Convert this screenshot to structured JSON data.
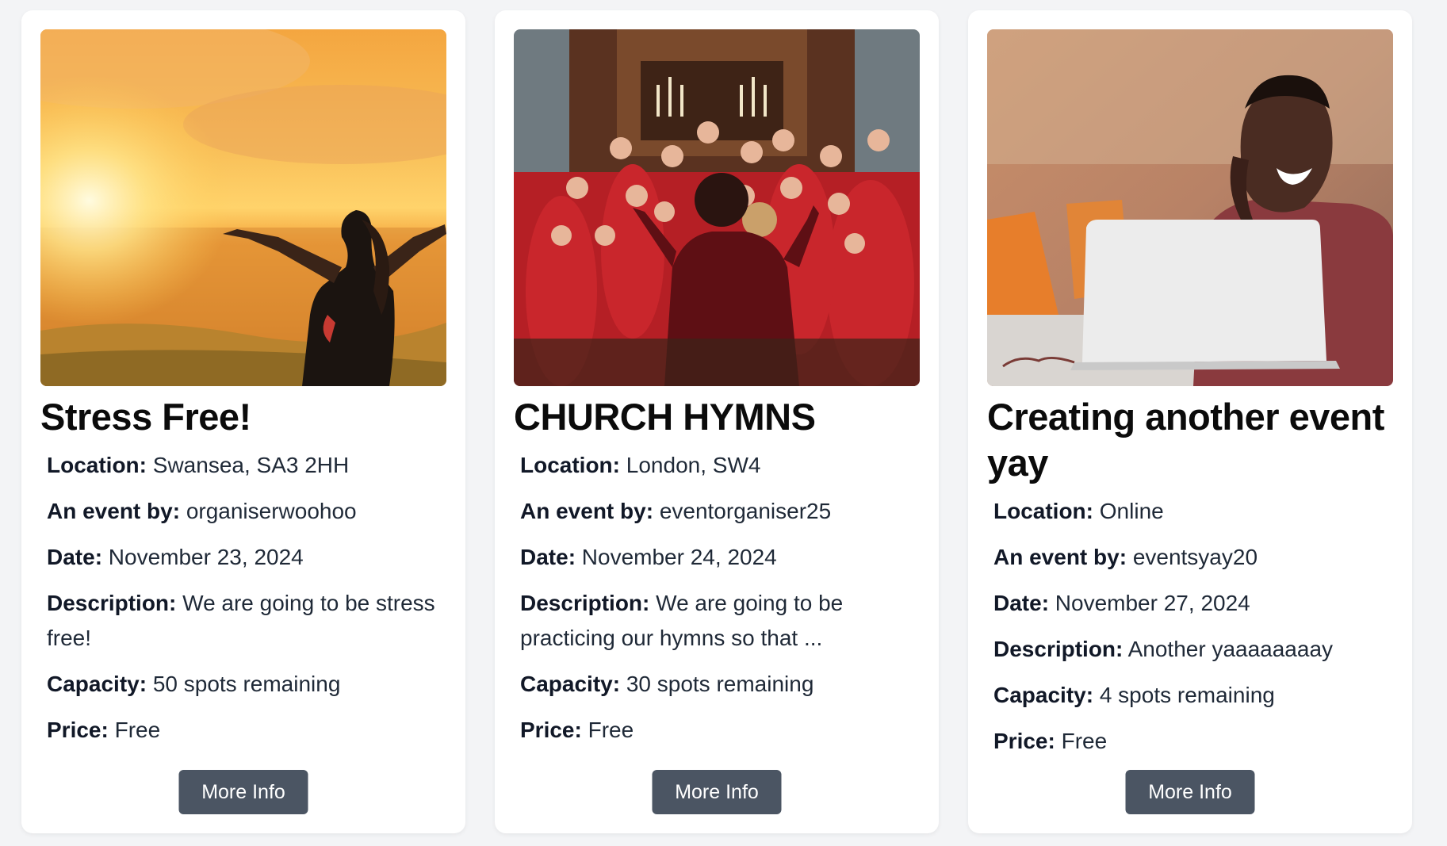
{
  "events": [
    {
      "title": "Stress Free!",
      "location_label": "Location:",
      "location": "Swansea, SA3 2HH",
      "organiser_label": "An event by:",
      "organiser": "organiserwoohoo",
      "date_label": "Date:",
      "date": "November 23, 2024",
      "description_label": "Description:",
      "description": "We are going to be stress free!",
      "capacity_label": "Capacity:",
      "capacity": "50 spots remaining",
      "price_label": "Price:",
      "price": "Free",
      "button_label": "More Info",
      "image": "sunset-woman-photo"
    },
    {
      "title": "CHURCH HYMNS",
      "location_label": "Location:",
      "location": "London, SW4",
      "organiser_label": "An event by:",
      "organiser": "eventorganiser25",
      "date_label": "Date:",
      "date": "November 24, 2024",
      "description_label": "Description:",
      "description": "We are going to be practicing our hymns so that ...",
      "capacity_label": "Capacity:",
      "capacity": "30 spots remaining",
      "price_label": "Price:",
      "price": "Free",
      "button_label": "More Info",
      "image": "church-choir-photo"
    },
    {
      "title": "Creating another event yay",
      "location_label": "Location:",
      "location": "Online",
      "organiser_label": "An event by:",
      "organiser": "eventsyay20",
      "date_label": "Date:",
      "date": "November 27, 2024",
      "description_label": "Description:",
      "description": "Another yaaaaaaaay",
      "capacity_label": "Capacity:",
      "capacity": "4 spots remaining",
      "price_label": "Price:",
      "price": "Free",
      "button_label": "More Info",
      "image": "man-on-phone-laptop-photo"
    }
  ],
  "colors": {
    "page_bg": "#f3f4f6",
    "card_bg": "#ffffff",
    "button_bg": "#4b5563",
    "button_text": "#ffffff"
  }
}
